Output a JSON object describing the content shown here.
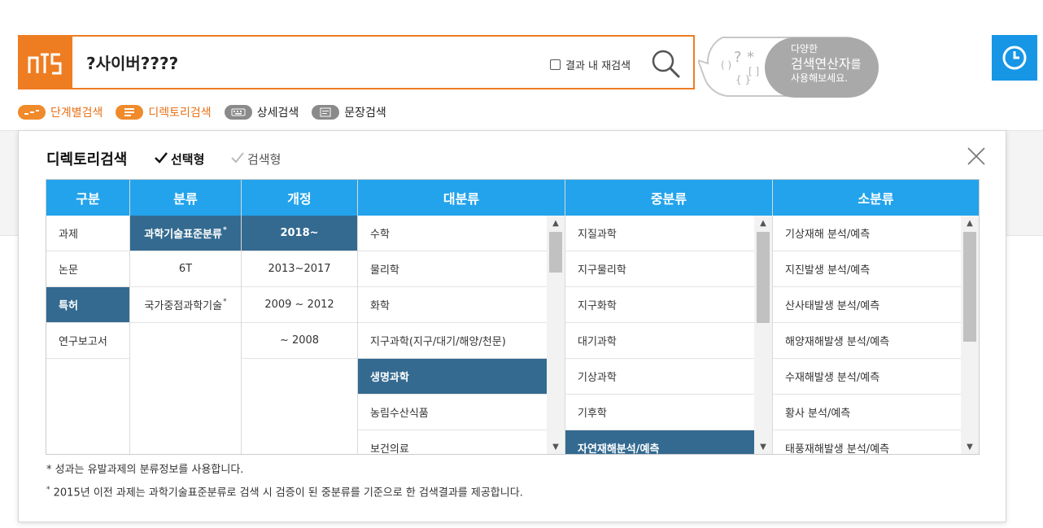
{
  "search": {
    "query": "?사이버????",
    "recheck_label": "결과 내 재검색"
  },
  "bubble": {
    "line1": "다양한",
    "line2": "검색연산자",
    "line2_suffix": "를",
    "line3": "사용해보세요."
  },
  "tabs": [
    {
      "label": "단계별검색"
    },
    {
      "label": "디렉토리검색"
    },
    {
      "label": "상세검색"
    },
    {
      "label": "문장검색"
    }
  ],
  "modal": {
    "title": "디렉토리검색",
    "option_select": "선택형",
    "option_search": "검색형"
  },
  "columns": {
    "gubun": {
      "header": "구분",
      "items": [
        "과제",
        "논문",
        "특허",
        "연구보고서"
      ],
      "selected": "특허"
    },
    "bunryu": {
      "header": "분류",
      "items": [
        "과학기술표준분류",
        "6T",
        "국가중점과학기술"
      ],
      "selected": "과학기술표준분류"
    },
    "gaejeong": {
      "header": "개정",
      "items": [
        "2018~",
        "2013~2017",
        "2009 ~ 2012",
        "~ 2008"
      ],
      "selected": "2018~"
    },
    "daebunryu": {
      "header": "대분류",
      "items": [
        "수학",
        "물리학",
        "화학",
        "지구과학(지구/대기/해양/천문)",
        "생명과학",
        "농림수산식품",
        "보건의료"
      ],
      "selected": "생명과학"
    },
    "jungbunryu": {
      "header": "중분류",
      "items": [
        "지질과학",
        "지구물리학",
        "지구화학",
        "대기과학",
        "기상과학",
        "기후학",
        "자연재해분석/예측"
      ],
      "selected": "자연재해분석/예측"
    },
    "sobunryu": {
      "header": "소분류",
      "items": [
        "기상재해 분석/예측",
        "지진발생 분석/예측",
        "산사태발생 분석/예측",
        "해양재해발생 분석/예측",
        "수재해발생 분석/예측",
        "황사 분석/예측",
        "태풍재해발생 분석/예측"
      ]
    }
  },
  "footnotes": {
    "note1": "* 성과는 유발과제의 분류정보를 사용합니다.",
    "note2": "2015년 이전 과제는 과학기술표준분류로 검색 시 검증이 된 중분류를 기준으로 한 검색결과를 제공합니다."
  },
  "colors": {
    "brand_orange": "#ee7d22",
    "header_blue": "#22a3ec",
    "selected_navy": "#346a90",
    "clock_blue": "#1796e6"
  }
}
